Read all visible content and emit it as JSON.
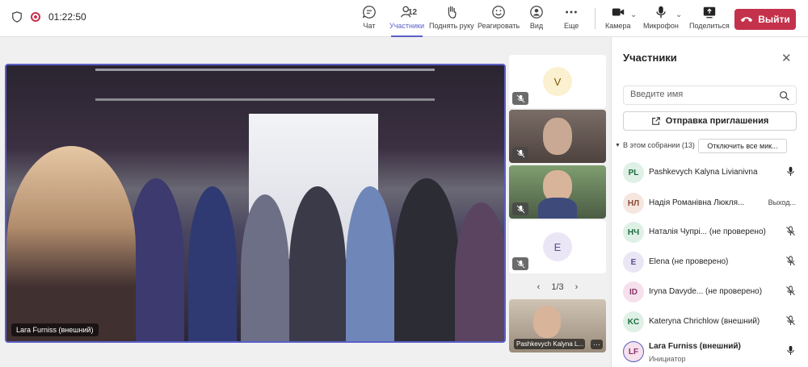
{
  "topbar": {
    "timer": "01:22:50",
    "participants_count": "12",
    "buttons": {
      "chat": "Чат",
      "participants": "Участники",
      "raise": "Поднять руку",
      "react": "Реагировать",
      "view": "Вид",
      "more": "Еще",
      "camera": "Камера",
      "mic": "Микрофон",
      "share": "Поделиться"
    },
    "leave": "Выйти"
  },
  "stage": {
    "label": "Lara Furniss (внешний)"
  },
  "tiles": {
    "t1_initial": "V",
    "t4_initial": "E",
    "pager": "1/3",
    "bottom_label": "Pashkevych Kalyna L...",
    "bottom_more": "···"
  },
  "panel": {
    "title": "Участники",
    "search_placeholder": "Введите имя",
    "invite": "Отправка приглашения",
    "section": "В этом собрании (13)",
    "mute_all": "Отключить все мик...",
    "people": [
      {
        "initials": "PL",
        "name": "Pashkevych Kalyna Livianivna",
        "status": "",
        "color": "#dff0e6",
        "fg": "#1a6b3c",
        "icon": "mic"
      },
      {
        "initials": "НЛ",
        "name": "Надія Романівна Люкля...",
        "status": "Выход...",
        "color": "#f5e6e0",
        "fg": "#8a4a33",
        "icon": ""
      },
      {
        "initials": "НЧ",
        "name": "Наталія Чупрі... (не проверено)",
        "status": "",
        "color": "#dff0e6",
        "fg": "#1a6b3c",
        "icon": "mic-off"
      },
      {
        "initials": "E",
        "name": "Elena (не проверено)",
        "status": "",
        "color": "#ebe6f5",
        "fg": "#5b4a8a",
        "icon": "mic-off"
      },
      {
        "initials": "ID",
        "name": "Iryna Davyde... (не проверено)",
        "status": "",
        "color": "#f5e0ec",
        "fg": "#8a3366",
        "icon": "mic-off"
      },
      {
        "initials": "KC",
        "name": "Kateryna Chrichlow (внешний)",
        "status": "",
        "color": "#dff0e6",
        "fg": "#1a6b3c",
        "icon": "mic-off"
      },
      {
        "initials": "LF",
        "name": "Lara Furniss (внешний)",
        "status": "",
        "color": "#f5e0ec",
        "fg": "#8a3366",
        "icon": "mic",
        "sub": "Инициатор"
      }
    ]
  }
}
